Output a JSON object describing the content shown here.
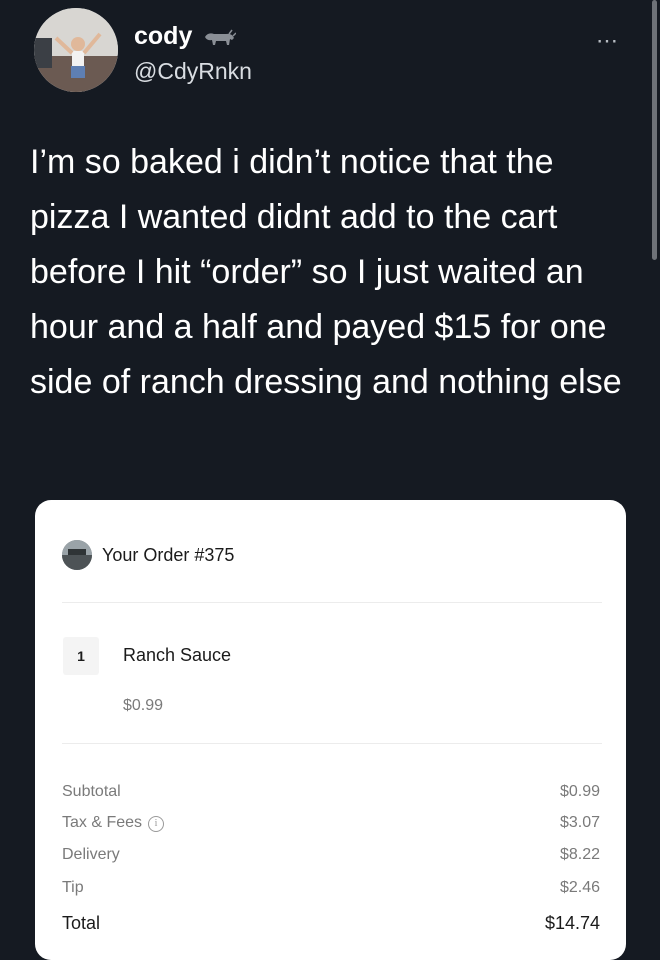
{
  "tweet": {
    "display_name": "cody",
    "handle": "@CdyRnkn",
    "more_icon": "⋯",
    "text": "I’m so baked i didn’t notice that the pizza I wanted didnt add to the cart before I hit “order” so I just waited an hour and a half and payed $15 for one side of ranch dressing and nothing else"
  },
  "receipt": {
    "order_title": "Your Order #375",
    "item": {
      "quantity": "1",
      "name": "Ranch Sauce",
      "price": "$0.99"
    },
    "summary": {
      "subtotal_label": "Subtotal",
      "subtotal_value": "$0.99",
      "tax_label": "Tax & Fees",
      "tax_info_icon": "i",
      "tax_value": "$3.07",
      "delivery_label": "Delivery",
      "delivery_value": "$8.22",
      "tip_label": "Tip",
      "tip_value": "$2.46",
      "total_label": "Total",
      "total_value": "$14.74"
    }
  },
  "colors": {
    "background": "#151a22",
    "card": "#ffffff",
    "muted_text": "#7a7a7a"
  },
  "icons": {
    "name_emoji": "bull-icon",
    "more": "more-options-icon",
    "info": "info-icon"
  }
}
